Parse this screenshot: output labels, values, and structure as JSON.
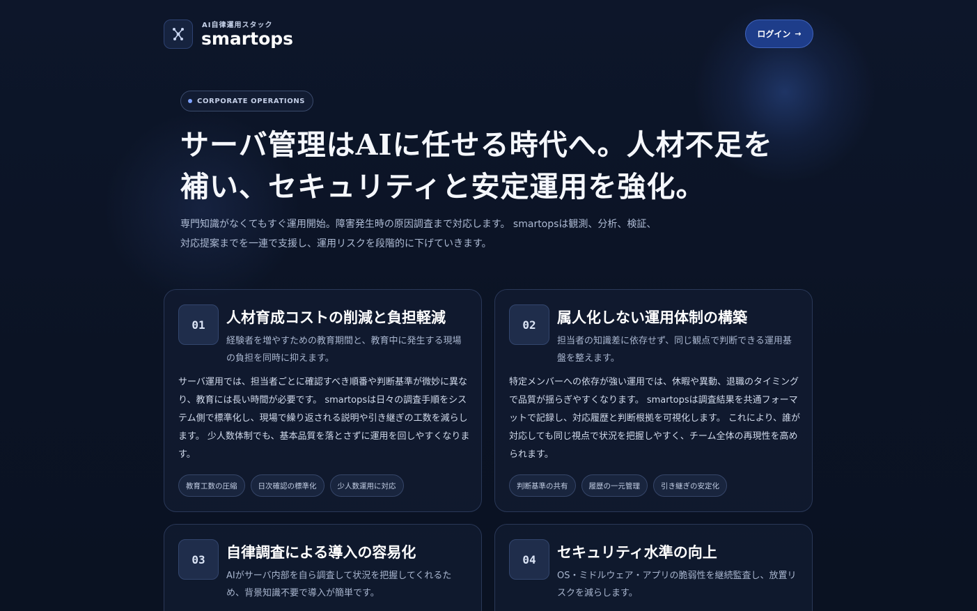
{
  "header": {
    "brand_tagline": "AI自律運用スタック",
    "brand_name": "smartops",
    "login_label": "ログイン",
    "login_arrow": "→",
    "logo_icon": "network-nodes-icon"
  },
  "hero": {
    "badge": "CORPORATE OPERATIONS",
    "title": "サーバ管理はAIに任せる時代へ。人材不足を補い、セキュリティと安定運用を強化。",
    "description": "専門知識がなくてもすぐ運用開始。障害発生時の原因調査まで対応します。 smartopsは観測、分析、検証、対応提案までを一連で支援し、運用リスクを段階的に下げていきます。"
  },
  "cards": [
    {
      "number": "01",
      "title": "人材育成コストの削減と負担軽減",
      "subtitle": "経験者を増やすための教育期間と、教育中に発生する現場の負担を同時に抑えます。",
      "body": "サーバ運用では、担当者ごとに確認すべき順番や判断基準が微妙に異なり、教育には長い時間が必要です。 smartopsは日々の調査手順をシステム側で標準化し、現場で繰り返される説明や引き継ぎの工数を減らします。 少人数体制でも、基本品質を落とさずに運用を回しやすくなります。",
      "tags": [
        "教育工数の圧縮",
        "日次確認の標準化",
        "少人数運用に対応"
      ]
    },
    {
      "number": "02",
      "title": "属人化しない運用体制の構築",
      "subtitle": "担当者の知識差に依存せず、同じ観点で判断できる運用基盤を整えます。",
      "body": "特定メンバーへの依存が強い運用では、休暇や異動、退職のタイミングで品質が揺らぎやすくなります。 smartopsは調査結果を共通フォーマットで記録し、対応履歴と判断根拠を可視化します。 これにより、誰が対応しても同じ視点で状況を把握しやすく、チーム全体の再現性を高められます。",
      "tags": [
        "判断基準の共有",
        "履歴の一元管理",
        "引き継ぎの安定化"
      ]
    },
    {
      "number": "03",
      "title": "自律調査による導入の容易化",
      "subtitle": "AIがサーバ内部を自ら調査して状況を把握してくれるため、背景知識不要で導入が簡単です。"
    },
    {
      "number": "04",
      "title": "セキュリティ水準の向上",
      "subtitle": "OS・ミドルウェア・アプリの脆弱性を継続監査し、放置リスクを減らします。"
    }
  ]
}
